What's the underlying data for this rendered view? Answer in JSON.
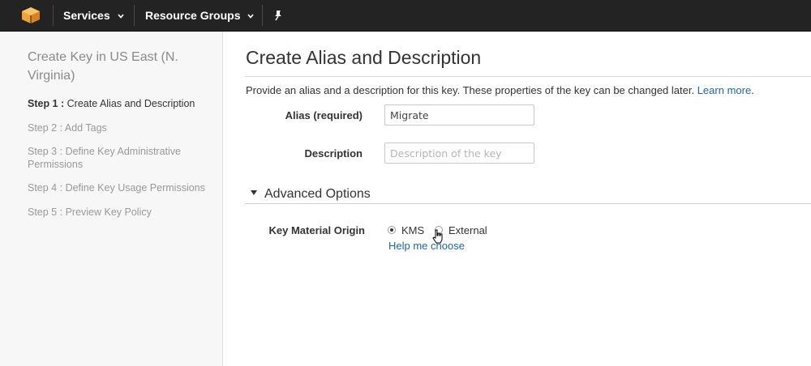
{
  "nav": {
    "services_label": "Services",
    "resource_groups_label": "Resource Groups"
  },
  "sidebar": {
    "title": "Create Key in US East (N. Virginia)",
    "steps": [
      {
        "num": "Step 1 :",
        "label": "Create Alias and Description",
        "active": true
      },
      {
        "num": "Step 2 :",
        "label": "Add Tags",
        "active": false
      },
      {
        "num": "Step 3 :",
        "label": "Define Key Administrative Permissions",
        "active": false
      },
      {
        "num": "Step 4 :",
        "label": "Define Key Usage Permissions",
        "active": false
      },
      {
        "num": "Step 5 :",
        "label": "Preview Key Policy",
        "active": false
      }
    ]
  },
  "main": {
    "title": "Create Alias and Description",
    "intro": "Provide an alias and a description for this key. These properties of the key can be changed later.",
    "learn_more": "Learn more",
    "intro_end": ".",
    "alias": {
      "label": "Alias (required)",
      "value": "Migrate"
    },
    "description": {
      "label": "Description",
      "placeholder": "Description of the key",
      "value": ""
    },
    "advanced": {
      "heading": "Advanced Options",
      "key_material_origin_label": "Key Material Origin",
      "options": [
        {
          "label": "KMS",
          "selected": true
        },
        {
          "label": "External",
          "selected": false
        }
      ],
      "help_link": "Help me choose"
    }
  },
  "colors": {
    "topbar": "#232323",
    "sidebar_bg": "#f7f7f7",
    "link": "#1a65b0",
    "logo": "#f1a33a"
  }
}
